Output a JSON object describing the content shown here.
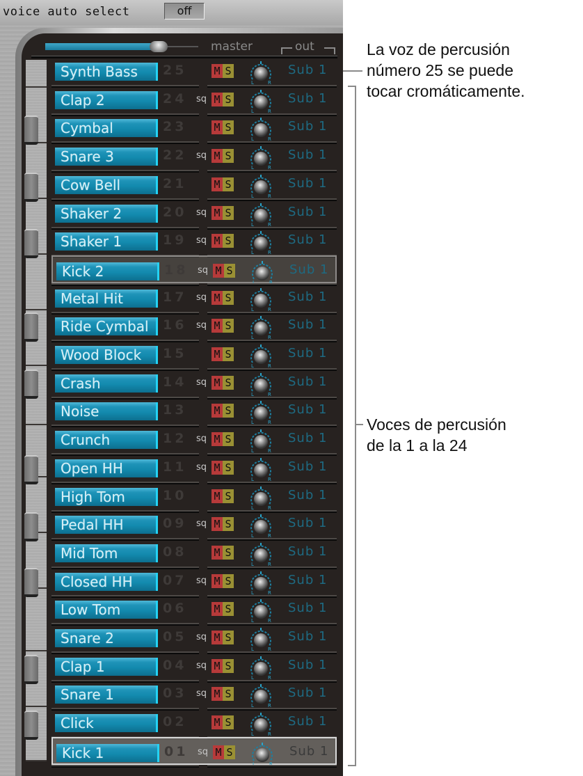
{
  "header": {
    "voice_auto_select_label": "voice auto select",
    "voice_auto_select_value": "off",
    "master_label": "master",
    "master_level": 0.74,
    "out_label": "out"
  },
  "voices": [
    {
      "number": "25",
      "name": "Synth Bass",
      "sq": false,
      "mute": "M",
      "solo": "S",
      "out": "Sub 1"
    },
    {
      "number": "24",
      "name": "Clap 2",
      "sq": true,
      "mute": "M",
      "solo": "S",
      "out": "Sub 1"
    },
    {
      "number": "23",
      "name": "Cymbal",
      "sq": false,
      "mute": "M",
      "solo": "S",
      "out": "Sub 1"
    },
    {
      "number": "22",
      "name": "Snare 3",
      "sq": true,
      "mute": "M",
      "solo": "S",
      "out": "Sub 1"
    },
    {
      "number": "21",
      "name": "Cow Bell",
      "sq": false,
      "mute": "M",
      "solo": "S",
      "out": "Sub 1"
    },
    {
      "number": "20",
      "name": "Shaker 2",
      "sq": true,
      "mute": "M",
      "solo": "S",
      "out": "Sub 1"
    },
    {
      "number": "19",
      "name": "Shaker 1",
      "sq": true,
      "mute": "M",
      "solo": "S",
      "out": "Sub 1"
    },
    {
      "number": "18",
      "name": "Kick 2",
      "sq": true,
      "mute": "M",
      "solo": "S",
      "out": "Sub 1",
      "selected": true
    },
    {
      "number": "17",
      "name": "Metal Hit",
      "sq": true,
      "mute": "M",
      "solo": "S",
      "out": "Sub 1"
    },
    {
      "number": "16",
      "name": "Ride Cymbal",
      "sq": true,
      "mute": "M",
      "solo": "S",
      "out": "Sub 1"
    },
    {
      "number": "15",
      "name": "Wood Block",
      "sq": false,
      "mute": "M",
      "solo": "S",
      "out": "Sub 1"
    },
    {
      "number": "14",
      "name": "Crash",
      "sq": true,
      "mute": "M",
      "solo": "S",
      "out": "Sub 1"
    },
    {
      "number": "13",
      "name": "Noise",
      "sq": false,
      "mute": "M",
      "solo": "S",
      "out": "Sub 1"
    },
    {
      "number": "12",
      "name": "Crunch",
      "sq": true,
      "mute": "M",
      "solo": "S",
      "out": "Sub 1"
    },
    {
      "number": "11",
      "name": "Open HH",
      "sq": true,
      "mute": "M",
      "solo": "S",
      "out": "Sub 1"
    },
    {
      "number": "10",
      "name": "High Tom",
      "sq": false,
      "mute": "M",
      "solo": "S",
      "out": "Sub 1"
    },
    {
      "number": "09",
      "name": "Pedal HH",
      "sq": true,
      "mute": "M",
      "solo": "S",
      "out": "Sub 1"
    },
    {
      "number": "08",
      "name": "Mid Tom",
      "sq": false,
      "mute": "M",
      "solo": "S",
      "out": "Sub 1"
    },
    {
      "number": "07",
      "name": "Closed HH",
      "sq": true,
      "mute": "M",
      "solo": "S",
      "out": "Sub 1"
    },
    {
      "number": "06",
      "name": "Low Tom",
      "sq": false,
      "mute": "M",
      "solo": "S",
      "out": "Sub 1"
    },
    {
      "number": "05",
      "name": "Snare 2",
      "sq": true,
      "mute": "M",
      "solo": "S",
      "out": "Sub 1"
    },
    {
      "number": "04",
      "name": "Clap 1",
      "sq": true,
      "mute": "M",
      "solo": "S",
      "out": "Sub 1"
    },
    {
      "number": "03",
      "name": "Snare 1",
      "sq": true,
      "mute": "M",
      "solo": "S",
      "out": "Sub 1"
    },
    {
      "number": "02",
      "name": "Click",
      "sq": false,
      "mute": "M",
      "solo": "S",
      "out": "Sub 1"
    },
    {
      "number": "01",
      "name": "Kick 1",
      "sq": true,
      "mute": "M",
      "solo": "S",
      "out": "Sub 1",
      "selected": true,
      "active": true
    }
  ],
  "sq_label": "sq",
  "annotations": {
    "voice25": [
      "La voz de percusión",
      "número 25 se puede",
      "tocar cromáticamente."
    ],
    "voices1to24": [
      "Voces de percusión",
      "de la 1 a la 24"
    ]
  }
}
